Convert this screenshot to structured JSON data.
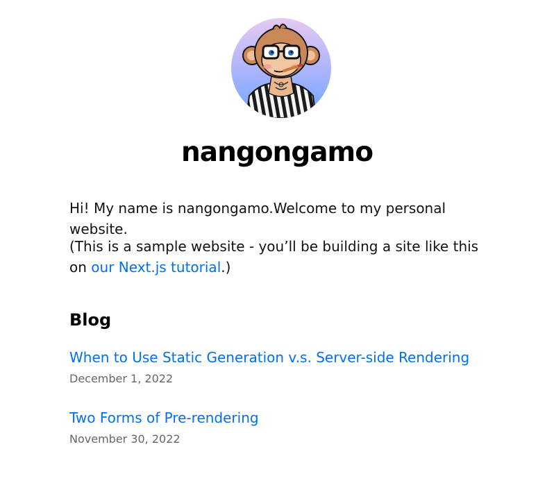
{
  "profile": {
    "name": "nangongamo",
    "avatar_icon": "monkey-avatar"
  },
  "intro": {
    "text": "Hi! My name is nangongamo.Welcome to my personal website."
  },
  "note": {
    "prefix": "(This is a sample website - you’ll be building a site like this on ",
    "link_label": "our Next.js tutorial",
    "suffix": ".)"
  },
  "blog": {
    "heading": "Blog",
    "posts": [
      {
        "title": "When to Use Static Generation v.s. Server-side Rendering",
        "date": "December 1, 2022"
      },
      {
        "title": "Two Forms of Pre-rendering",
        "date": "November 30, 2022"
      }
    ]
  },
  "colors": {
    "link": "#0070f3",
    "date": "#666666",
    "avatar_gradient_top": "#e3c8f3",
    "avatar_gradient_bottom": "#6ea6ff"
  }
}
